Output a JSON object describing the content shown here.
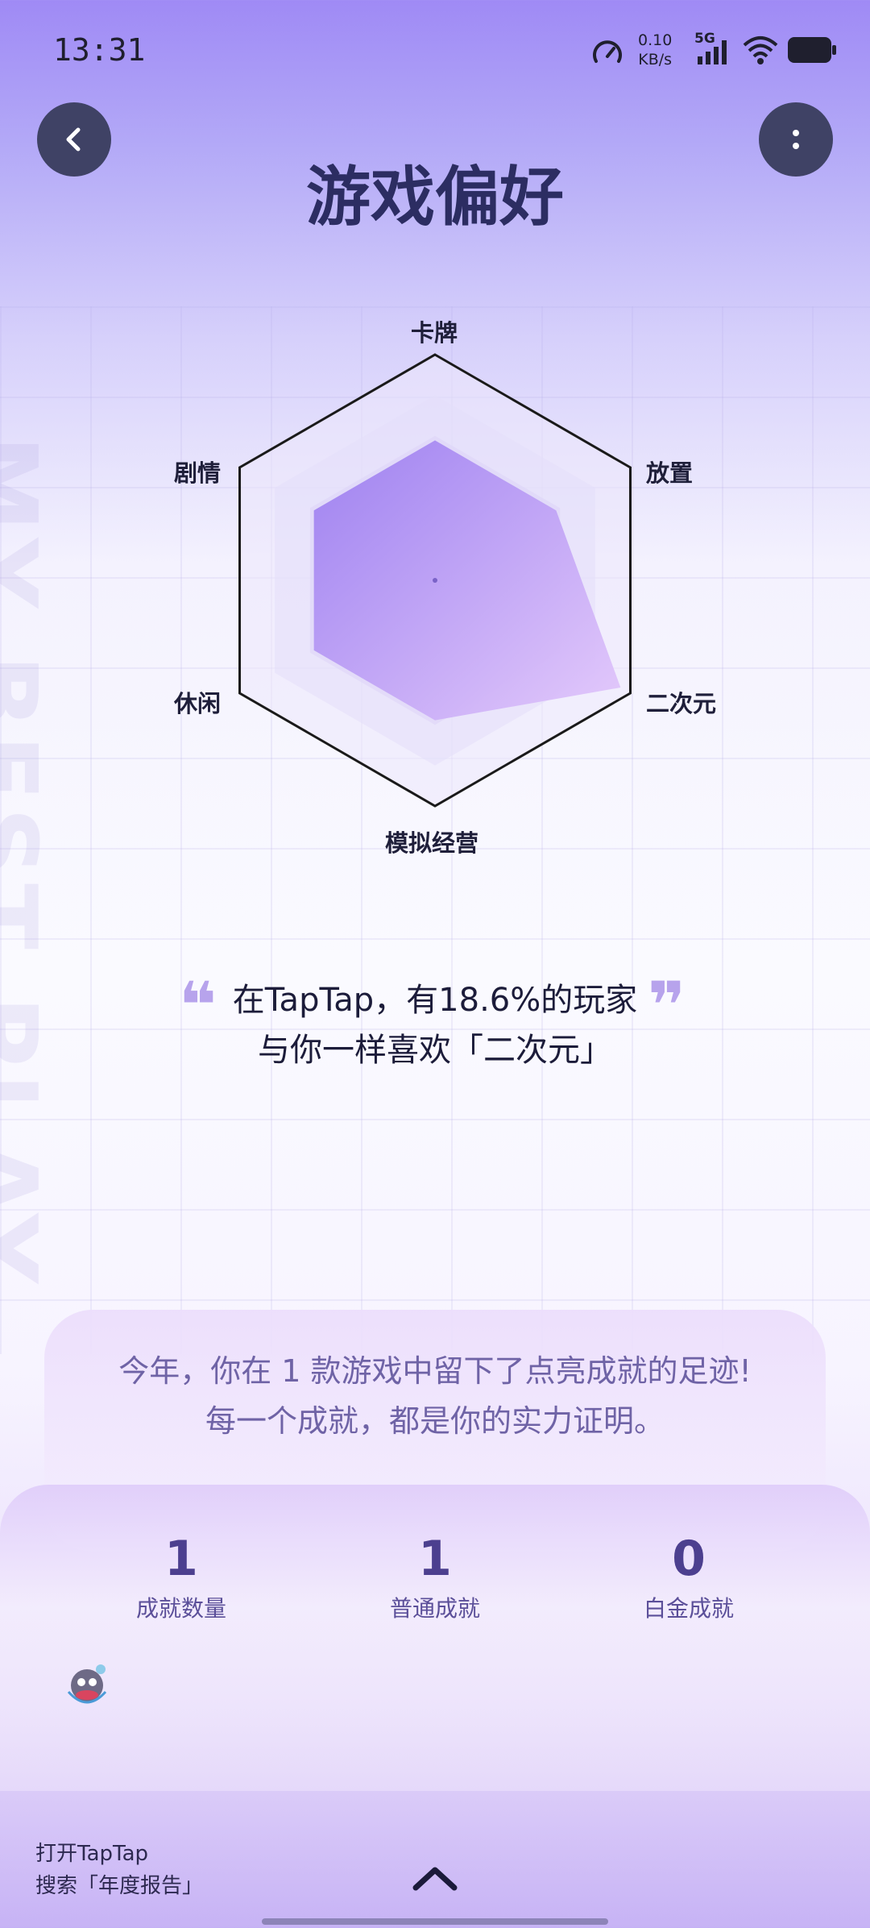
{
  "status_bar": {
    "time": "13:31",
    "speed_value": "0.10",
    "speed_unit": "KB/s",
    "network": "5G"
  },
  "header": {
    "title": "游戏偏好",
    "back_icon": "chevron-left-icon",
    "more_icon": "more-vertical-icon"
  },
  "radar": {
    "axes": [
      "卡牌",
      "放置",
      "二次元",
      "模拟经营",
      "休闲",
      "剧情"
    ],
    "values": [
      0.62,
      0.62,
      0.95,
      0.62,
      0.62,
      0.62
    ],
    "fill_colors": [
      "#9b7df0",
      "#e3c8fb"
    ],
    "outline_color": "#1a1a1a"
  },
  "side_decoration": {
    "text": "MY BEST PLAY"
  },
  "quote": {
    "line1": "在TapTap，有18.6%的玩家",
    "line2": "与你一样喜欢「二次元」",
    "open_mark": "❝",
    "close_mark": "❞"
  },
  "achievements": {
    "line1": "今年，你在 1 款游戏中留下了点亮成就的足迹!",
    "line2": "每一个成就，都是你的实力证明。",
    "stats": [
      {
        "value": "1",
        "label": "成就数量"
      },
      {
        "value": "1",
        "label": "普通成就"
      },
      {
        "value": "0",
        "label": "白金成就"
      }
    ]
  },
  "footer": {
    "hint_line1": "打开TapTap",
    "hint_line2": "搜索「年度报告」",
    "up_icon": "chevron-up-icon"
  }
}
